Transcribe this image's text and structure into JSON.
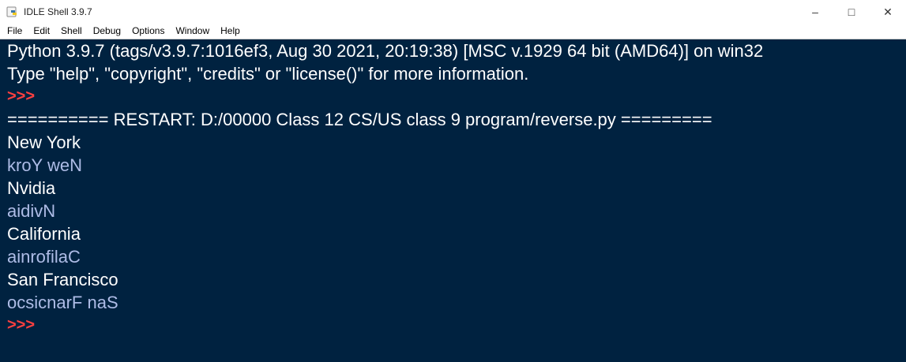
{
  "window": {
    "title": "IDLE Shell 3.9.7",
    "icon": "python-idle-icon",
    "controls": {
      "minimize": "–",
      "maximize": "□",
      "close": "✕"
    }
  },
  "menu": [
    "File",
    "Edit",
    "Shell",
    "Debug",
    "Options",
    "Window",
    "Help"
  ],
  "shell": {
    "background": "#002240",
    "lines": [
      {
        "kind": "out",
        "text": "Python 3.9.7 (tags/v3.9.7:1016ef3, Aug 30 2021, 20:19:38) [MSC v.1929 64 bit (AMD64)] on win32"
      },
      {
        "kind": "out",
        "text": "Type \"help\", \"copyright\", \"credits\" or \"license()\" for more information."
      },
      {
        "kind": "prompt",
        "text": ">>>"
      },
      {
        "kind": "out",
        "text": "========== RESTART: D:/00000 Class 12 CS/US class 9 program/reverse.py ========="
      },
      {
        "kind": "inp",
        "text": "New York"
      },
      {
        "kind": "stdout",
        "text": "kroY weN"
      },
      {
        "kind": "inp",
        "text": "Nvidia"
      },
      {
        "kind": "stdout",
        "text": "aidivN"
      },
      {
        "kind": "inp",
        "text": "California"
      },
      {
        "kind": "stdout",
        "text": "ainrofilaC"
      },
      {
        "kind": "inp",
        "text": "San Francisco"
      },
      {
        "kind": "stdout",
        "text": "ocsicnarF naS"
      },
      {
        "kind": "prompt",
        "text": ">>>"
      }
    ]
  }
}
